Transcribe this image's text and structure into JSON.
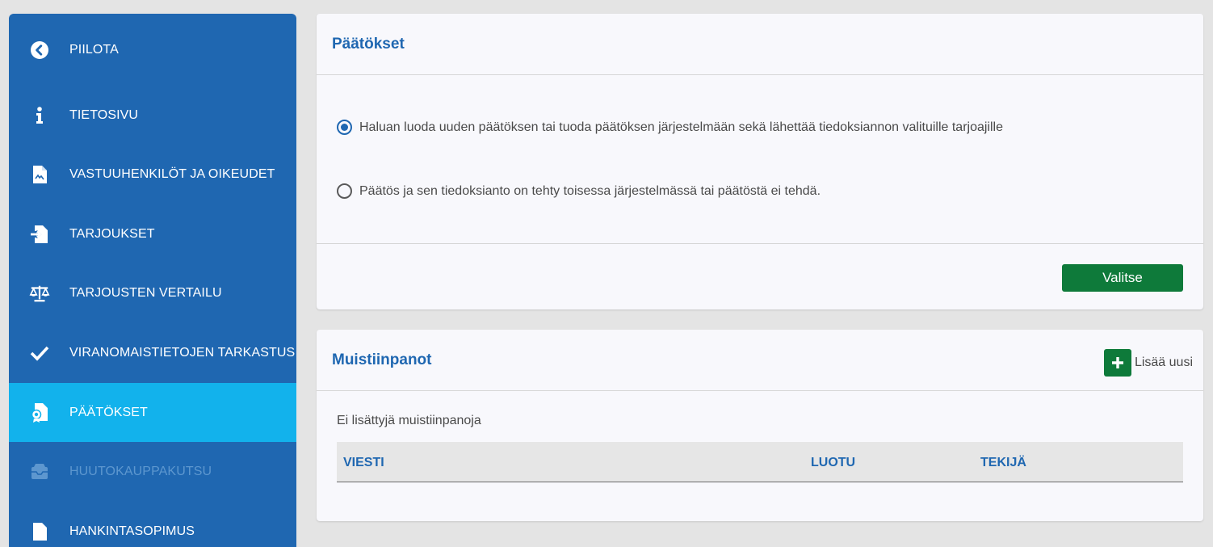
{
  "sidebar": {
    "items": [
      {
        "label": "PIILOTA",
        "icon": "chevron-left-circle-icon"
      },
      {
        "label": "TIETOSIVU",
        "icon": "info-icon"
      },
      {
        "label": "VASTUUHENKILÖT JA OIKEUDET",
        "icon": "document-icon"
      },
      {
        "label": "TARJOUKSET",
        "icon": "document-import-icon"
      },
      {
        "label": "TARJOUSTEN VERTAILU",
        "icon": "scale-icon"
      },
      {
        "label": "VIRANOMAISTIETOJEN TARKASTUS",
        "icon": "checkmark-icon"
      },
      {
        "label": "PÄÄTÖKSET",
        "icon": "document-award-icon",
        "active": true
      },
      {
        "label": "HUUTOKAUPPAKUTSU",
        "icon": "mail-tray-icon",
        "disabled": true
      },
      {
        "label": "HANKINTASOPIMUS",
        "icon": "document-icon"
      }
    ],
    "colors": {
      "background": "#1f67b1",
      "active": "#12b2ec"
    }
  },
  "decisions_panel": {
    "title": "Päätökset",
    "options": [
      {
        "label": "Haluan luoda uuden päätöksen tai tuoda päätöksen järjestelmään sekä lähettää tiedoksiannon valituille tarjoajille",
        "checked": true
      },
      {
        "label": "Päätös ja sen tiedoksianto on tehty toisessa järjestelmässä tai päätöstä ei tehdä.",
        "checked": false
      }
    ],
    "select_button": "Valitse"
  },
  "notes_panel": {
    "title": "Muistiinpanot",
    "add_new_label": "Lisää uusi",
    "empty_text": "Ei lisättyjä muistiinpanoja",
    "columns": [
      "VIESTI",
      "LUOTU",
      "TEKIJÄ"
    ]
  },
  "colors": {
    "accent": "#1f67b1",
    "button_green": "#0e7a3a"
  }
}
